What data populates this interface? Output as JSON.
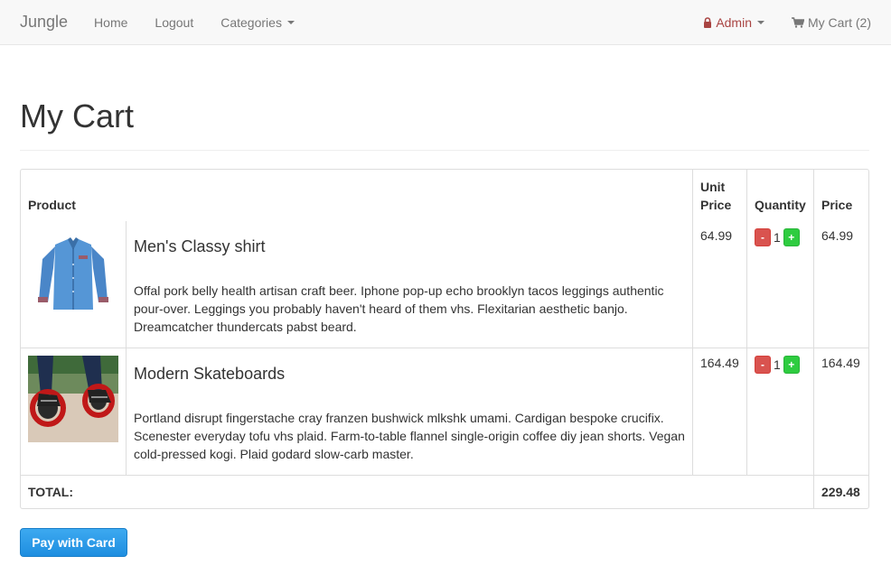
{
  "nav": {
    "brand": "Jungle",
    "home": "Home",
    "logout": "Logout",
    "categories": "Categories",
    "admin": "Admin",
    "cart": "My Cart (2)"
  },
  "page": {
    "title": "My Cart"
  },
  "table": {
    "headers": {
      "product": "Product",
      "unit_price": "Unit Price",
      "quantity": "Quantity",
      "price": "Price"
    },
    "items": [
      {
        "name": "Men's Classy shirt",
        "description": "Offal pork belly health artisan craft beer. Iphone pop-up echo brooklyn tacos leggings authentic pour-over. Leggings you probably haven't heard of them vhs. Flexitarian aesthetic banjo. Dreamcatcher thundercats pabst beard.",
        "unit_price": "64.99",
        "quantity": "1",
        "price": "64.99",
        "minus": "-",
        "plus": "+"
      },
      {
        "name": "Modern Skateboards",
        "description": "Portland disrupt fingerstache cray franzen bushwick mlkshk umami. Cardigan bespoke crucifix. Scenester everyday tofu vhs plaid. Farm-to-table flannel single-origin coffee diy jean shorts. Vegan cold-pressed kogi. Plaid godard slow-carb master.",
        "unit_price": "164.49",
        "quantity": "1",
        "price": "164.49",
        "minus": "-",
        "plus": "+"
      }
    ],
    "total_label": "TOTAL:",
    "total_value": "229.48"
  },
  "pay_button": "Pay with Card",
  "colors": {
    "admin": "#a94442",
    "minus_button": "#d9534f",
    "plus_button": "#2ecc40",
    "pay_button": "#1e8ee0"
  },
  "icons": {
    "admin": "lock-icon",
    "cart": "shopping-cart-icon"
  }
}
